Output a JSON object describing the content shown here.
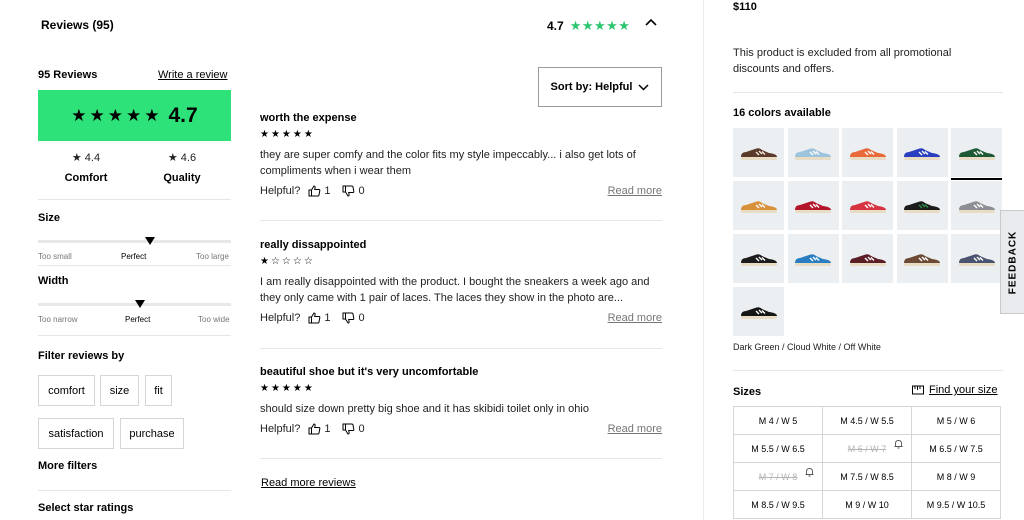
{
  "header": {
    "reviews_title": "Reviews (95)",
    "rating_value": "4.7",
    "rating_stars": "★★★★★",
    "collapse_icon": "chevron-up-icon"
  },
  "summary": {
    "count_label": "95 Reviews",
    "write_review": "Write a review",
    "big_stars": "★★★★★",
    "big_rating": "4.7",
    "comfort": {
      "star": "★",
      "value": "4.4",
      "label": "Comfort"
    },
    "quality": {
      "star": "★",
      "value": "4.6",
      "label": "Quality"
    }
  },
  "sliders": [
    {
      "title": "Size",
      "low": "Too small",
      "mid": "Perfect",
      "high": "Too large",
      "level": 0.58
    },
    {
      "title": "Width",
      "low": "Too narrow",
      "mid": "Perfect",
      "high": "Too wide",
      "level": 0.53
    }
  ],
  "filters": {
    "title": "Filter reviews by",
    "chips": [
      "comfort",
      "size",
      "fit",
      "satisfaction",
      "purchase"
    ],
    "more_filters": "More filters",
    "select_star_ratings": "Select star ratings"
  },
  "sort": {
    "label": "Sort by: Helpful",
    "icon": "chevron-down-icon"
  },
  "reviews": [
    {
      "title": "worth the expense",
      "stars": "★★★★★",
      "rating": 5,
      "body": "they are super comfy and the color fits my style impeccably... i also get lots of compliments when i wear them",
      "helpful_label": "Helpful?",
      "up": "1",
      "down": "0",
      "read_more": "Read more"
    },
    {
      "title": "really dissappointed",
      "stars": "★☆☆☆☆",
      "rating": 1,
      "body": "I am really disappointed with the product. I bought the sneakers a week ago and they only came with 1 pair of laces. The laces they show in the photo are...",
      "helpful_label": "Helpful?",
      "up": "1",
      "down": "0",
      "read_more": "Read more"
    },
    {
      "title": "beautiful shoe but it's very uncomfortable",
      "stars": "★★★★★",
      "rating": 5,
      "body": "should size down pretty big shoe and it has skibidi toilet only in ohio",
      "helpful_label": "Helpful?",
      "up": "1",
      "down": "0",
      "read_more": "Read more"
    }
  ],
  "read_more_reviews": "Read more reviews",
  "product": {
    "price": "$110",
    "promo_note": "This product is excluded from all promotional discounts and offers.",
    "colors_title": "16 colors available",
    "selected_color_name": "Dark Green / Cloud White / Off White",
    "swatch_colors": [
      [
        "#5a3a2a",
        "#f2e9dc"
      ],
      [
        "#9ec3dc",
        "#ffffff"
      ],
      [
        "#e86a3a",
        "#ffffff"
      ],
      [
        "#2a3fbf",
        "#ffffff"
      ],
      [
        "#1f5a36",
        "#ffffff"
      ],
      [
        "#d9903a",
        "#ffffff"
      ],
      [
        "#b3162a",
        "#ffffff"
      ],
      [
        "#d63440",
        "#ffffff"
      ],
      [
        "#1c1c1c",
        "#2a8f4a"
      ],
      [
        "#8d8f92",
        "#ffffff"
      ],
      [
        "#1b1b1b",
        "#ffffff"
      ],
      [
        "#2a7fc2",
        "#ffffff"
      ],
      [
        "#5a1e24",
        "#ffffff"
      ],
      [
        "#6b4a36",
        "#ffffff"
      ],
      [
        "#4a5470",
        "#ffffff"
      ],
      [
        "#151515",
        "#ffffff"
      ]
    ],
    "selected_swatch": 4,
    "sizes_title": "Sizes",
    "find_size": "Find your size",
    "find_size_icon": "ruler-icon",
    "sizes": [
      {
        "label": "M 4 / W 5",
        "available": true
      },
      {
        "label": "M 4.5 / W 5.5",
        "available": true
      },
      {
        "label": "M 5 / W 6",
        "available": true
      },
      {
        "label": "M 5.5 / W 6.5",
        "available": true
      },
      {
        "label": "M 6 / W 7",
        "available": false
      },
      {
        "label": "M 6.5 / W 7.5",
        "available": true
      },
      {
        "label": "M 7 / W 8",
        "available": false
      },
      {
        "label": "M 7.5 / W 8.5",
        "available": true
      },
      {
        "label": "M 8 / W 9",
        "available": true
      },
      {
        "label": "M 8.5 / W 9.5",
        "available": true
      },
      {
        "label": "M 9 / W 10",
        "available": true
      },
      {
        "label": "M 9.5 / W 10.5",
        "available": true
      }
    ]
  },
  "feedback_tab": "FEEDBACK",
  "colors": {
    "rating_green": "#2ee27a",
    "star_green": "#2cc56f",
    "muted": "#767677"
  }
}
